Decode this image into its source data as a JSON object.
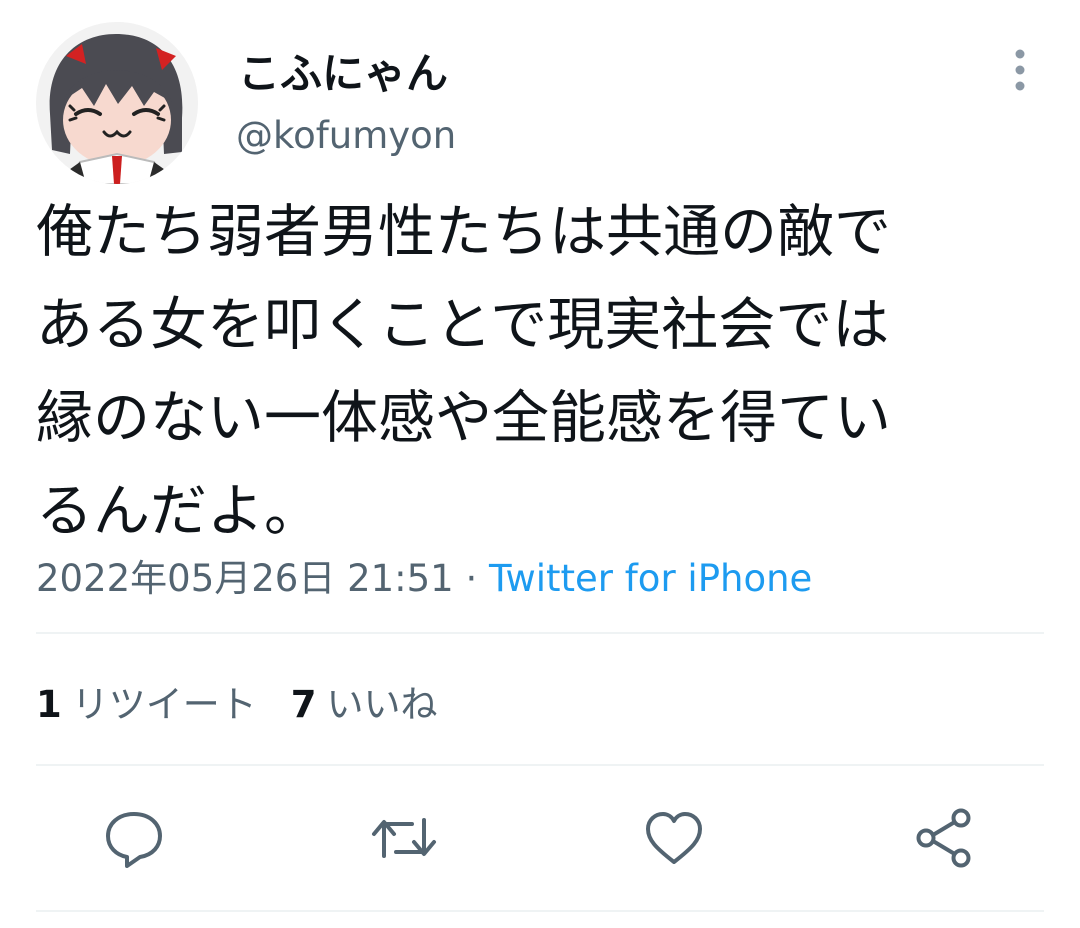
{
  "user": {
    "display_name": "こふにゃん",
    "handle": "@kofumyon"
  },
  "tweet": {
    "lines": [
      "俺たち弱者男性たちは共通の敵で",
      "ある女を叩くことで現実社会では",
      "縁のない一体感や全能感を得てい",
      "るんだよ。"
    ],
    "timestamp": "2022年05月26日 21:51",
    "separator": " · ",
    "source": "Twitter for iPhone"
  },
  "stats": {
    "retweets_count": "1",
    "retweets_label": "リツイート",
    "likes_count": "7",
    "likes_label": "いいね"
  },
  "actions": [
    "reply-icon",
    "retweet-icon",
    "like-icon",
    "share-icon"
  ],
  "colors": {
    "text": "#0f1419",
    "secondary": "#536471",
    "link": "#1d9bf0",
    "divider": "#eff3f4"
  }
}
